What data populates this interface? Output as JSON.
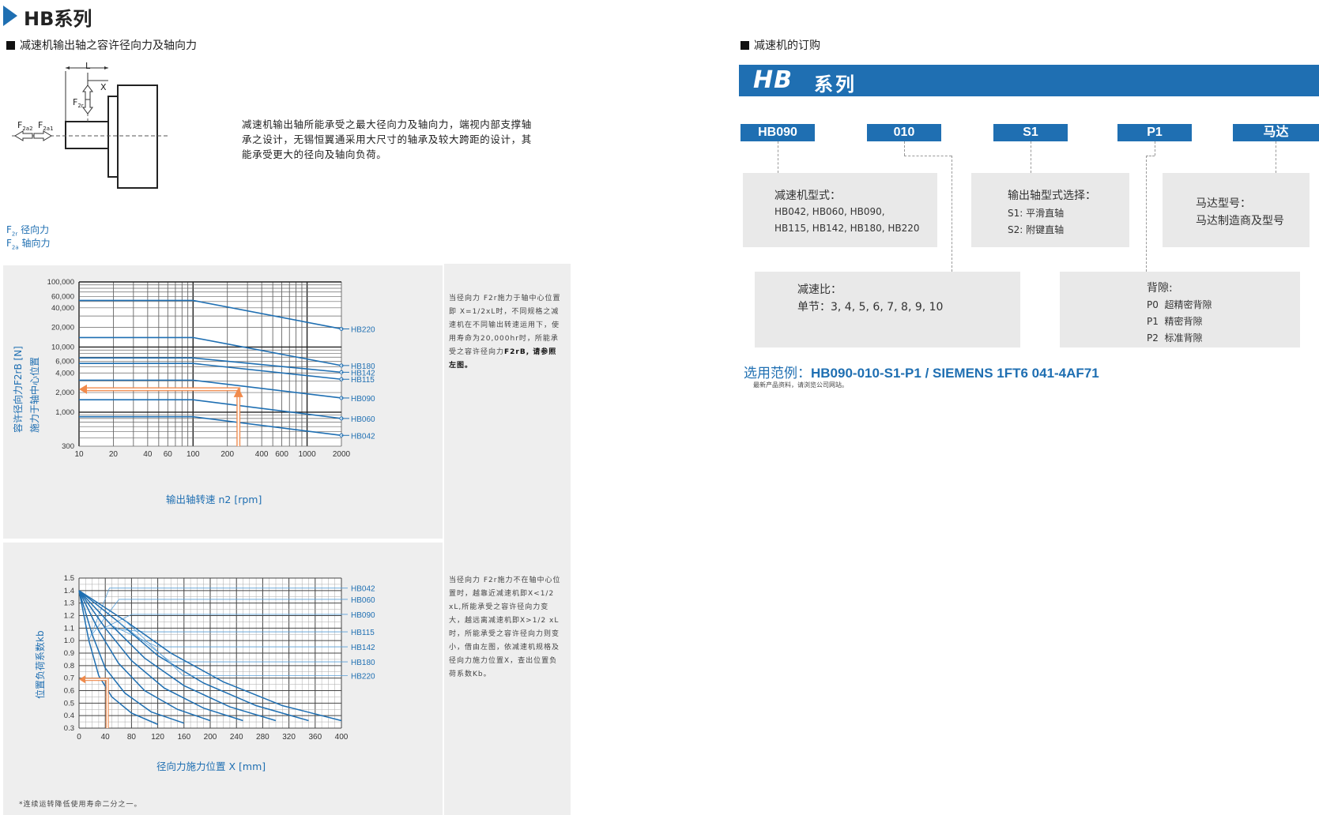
{
  "left": {
    "series_title": "HB系列",
    "section_title": "减速机输出轴之容许径向力及轴向力",
    "diagram_labels": {
      "L": "L",
      "X": "X",
      "F2r": "F",
      "F2r_sub": "2r",
      "F2a2": "F",
      "F2a2_sub": "2a2",
      "F2a1": "F",
      "F2a1_sub": "2a1"
    },
    "description": "减速机输出轴所能承受之最大径向力及轴向力，端视内部支撑轴承之设计，无锡恒翼通采用大尺寸的轴承及较大跨距的设计，其能承受更大的径向及轴向负荷。",
    "legend": {
      "radial": "径向力",
      "radial_prefix": "F",
      "radial_sub": "2r",
      "axial": "轴向力",
      "axial_prefix": "F",
      "axial_sub": "2a"
    },
    "note1": "当径向力 F2r施力于轴中心位置即 X=1/2xL时，不同规格之减速机在不同输出转速运用下，使用寿命为20,000hr时，所能承受之容许径向力",
    "note1_bold": "F2rB, 请参照左图。",
    "note2": "当径向力 F2r施力不在轴中心位置时，越靠近减速机即X<1/2 xL,所能承受之容许径向力变大，越远离减速机即X>1/2 xL时，所能承受之容许径向力则变小，借由左图，依减速机规格及径向力施力位置X，查出位置负荷系数Kb。",
    "footnote": "*连续运转降低使用寿命二分之一。"
  },
  "right": {
    "order_title": "减速机的订购",
    "banner_hb": "HB",
    "banner_series": "系列",
    "codes": [
      "HB090",
      "010",
      "S1",
      "P1",
      "马达"
    ],
    "box_model": {
      "title": "减速机型式：",
      "line1": "HB042, HB060, HB090,",
      "line2": "HB115, HB142, HB180, HB220"
    },
    "box_shaft": {
      "title": "输出轴型式选择：",
      "line1": "S1: 平滑直轴",
      "line2": "S2: 附键直轴"
    },
    "box_motor": {
      "title": "马达型号：",
      "line1": "马达制造商及型号"
    },
    "box_ratio": {
      "title": "减速比：",
      "line1": "单节：3, 4, 5, 6, 7, 8, 9, 10"
    },
    "box_backlash": {
      "title": "背隙:",
      "items": [
        "P0  超精密背隙",
        "P1  精密背隙",
        "P2  标准背隙"
      ]
    },
    "example_label": "选用范例：",
    "example_value": "HB090-010-S1-P1 / SIEMENS 1FT6 041-4AF71",
    "small_note": "最新产品资料，请浏览公司网站。"
  },
  "colors": {
    "accent": "#1f6fb2",
    "highlight": "#f08a4b",
    "panel": "#eeeeee"
  },
  "chart_data": [
    {
      "type": "line",
      "xlabel": "输出轴转速 n2 [rpm]",
      "ylabel": "容许径向力F2rB [N]",
      "ylabel2": "施力于轴中心位置",
      "xscale": "log",
      "yscale": "log",
      "xlim": [
        10,
        2000
      ],
      "ylim": [
        300,
        100000
      ],
      "xticks": [
        10,
        20,
        40,
        60,
        100,
        200,
        400,
        600,
        1000,
        2000
      ],
      "yticks": [
        300,
        1000,
        2000,
        4000,
        6000,
        10000,
        20000,
        40000,
        60000,
        100000
      ],
      "ytick_labels": [
        "300",
        "1,000",
        "2,000",
        "4,000",
        "6,000",
        "10,000",
        "20,000",
        "40,000",
        "60,000",
        "100,000"
      ],
      "series": [
        {
          "name": "HB220",
          "x": [
            10,
            100,
            2000
          ],
          "y": [
            52000,
            52000,
            19000
          ]
        },
        {
          "name": "HB180",
          "x": [
            10,
            100,
            2000
          ],
          "y": [
            14000,
            14000,
            5200
          ]
        },
        {
          "name": "HB142",
          "x": [
            10,
            100,
            2000
          ],
          "y": [
            6800,
            6800,
            4100
          ]
        },
        {
          "name": "HB115",
          "x": [
            10,
            100,
            2000
          ],
          "y": [
            5600,
            5600,
            3200
          ]
        },
        {
          "name": "HB090",
          "x": [
            10,
            100,
            2000
          ],
          "y": [
            3100,
            3100,
            1650
          ]
        },
        {
          "name": "HB060",
          "x": [
            10,
            100,
            2000
          ],
          "y": [
            1550,
            1550,
            800
          ]
        },
        {
          "name": "HB042",
          "x": [
            10,
            100,
            2000
          ],
          "y": [
            850,
            850,
            440
          ]
        }
      ],
      "highlight": {
        "x": 250,
        "y": 2250
      }
    },
    {
      "type": "line",
      "xlabel": "径向力施力位置 X [mm]",
      "ylabel": "位置负荷系数kb",
      "xlim": [
        0,
        400
      ],
      "ylim": [
        0.3,
        1.5
      ],
      "xticks": [
        0,
        40,
        80,
        120,
        160,
        200,
        240,
        280,
        320,
        360,
        400
      ],
      "yticks": [
        0.3,
        0.4,
        0.5,
        0.6,
        0.7,
        0.8,
        0.9,
        1.0,
        1.1,
        1.2,
        1.3,
        1.4,
        1.5
      ],
      "ytick_labels": [
        "0.3",
        "0.4",
        "0.5",
        "0.6",
        "0.7",
        "0.8",
        "0.9",
        "1.0",
        "1.1",
        "1.2",
        "1.3",
        "1.4",
        "1.5"
      ],
      "series": [
        {
          "name": "HB042",
          "x": [
            0,
            15,
            30,
            50,
            80,
            120
          ],
          "y": [
            1.4,
            1.0,
            0.72,
            0.55,
            0.42,
            0.33
          ]
        },
        {
          "name": "HB060",
          "x": [
            0,
            20,
            40,
            70,
            110,
            160
          ],
          "y": [
            1.4,
            1.05,
            0.78,
            0.58,
            0.43,
            0.34
          ]
        },
        {
          "name": "HB090",
          "x": [
            0,
            30,
            60,
            100,
            150,
            200
          ],
          "y": [
            1.4,
            1.08,
            0.82,
            0.6,
            0.45,
            0.36
          ]
        },
        {
          "name": "HB115",
          "x": [
            0,
            40,
            80,
            130,
            190,
            250
          ],
          "y": [
            1.4,
            1.1,
            0.84,
            0.62,
            0.46,
            0.36
          ]
        },
        {
          "name": "HB142",
          "x": [
            0,
            50,
            100,
            160,
            230,
            300
          ],
          "y": [
            1.4,
            1.12,
            0.86,
            0.64,
            0.47,
            0.36
          ]
        },
        {
          "name": "HB180",
          "x": [
            0,
            60,
            120,
            190,
            270,
            350
          ],
          "y": [
            1.4,
            1.15,
            0.88,
            0.66,
            0.48,
            0.36
          ]
        },
        {
          "name": "HB220",
          "x": [
            0,
            70,
            140,
            220,
            310,
            400
          ],
          "y": [
            1.4,
            1.16,
            0.9,
            0.67,
            0.48,
            0.36
          ]
        }
      ],
      "highlight": {
        "x": 43,
        "y": 0.69
      }
    }
  ]
}
